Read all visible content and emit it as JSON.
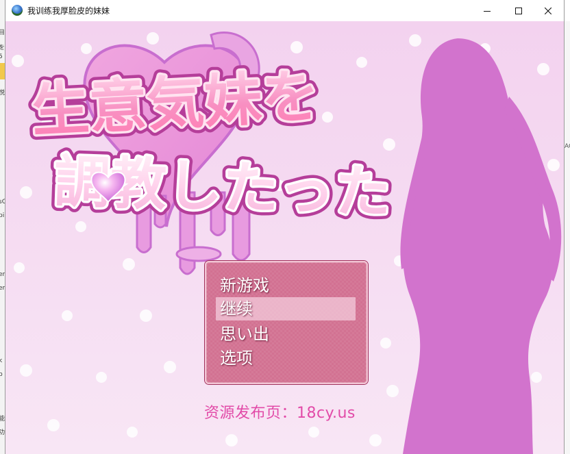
{
  "window": {
    "title": "我训练我厚脸皮的妹妹"
  },
  "background_app": {
    "left_fragments": [
      "目",
      "を_",
      "5",
      "悦",
      "sC",
      "pi",
      "en",
      "en",
      "k",
      "b",
      "能",
      "功"
    ],
    "right_fragment": "AC"
  },
  "game": {
    "logo_line1": "生意気妹を",
    "logo_line2": "調教したった",
    "menu": {
      "items": [
        {
          "label": "新游戏",
          "selected": false
        },
        {
          "label": "继续",
          "selected": true
        },
        {
          "label": "思い出",
          "selected": false
        },
        {
          "label": "选项",
          "selected": false
        }
      ]
    },
    "release_text": "资源发布页：18cy.us"
  },
  "colors": {
    "menu_accent": "#c4466c",
    "release_text": "#e24ba8",
    "silhouette": "#cf72cc",
    "logo_pink": "#f78fbf",
    "logo_outline": "#b53e9a"
  }
}
